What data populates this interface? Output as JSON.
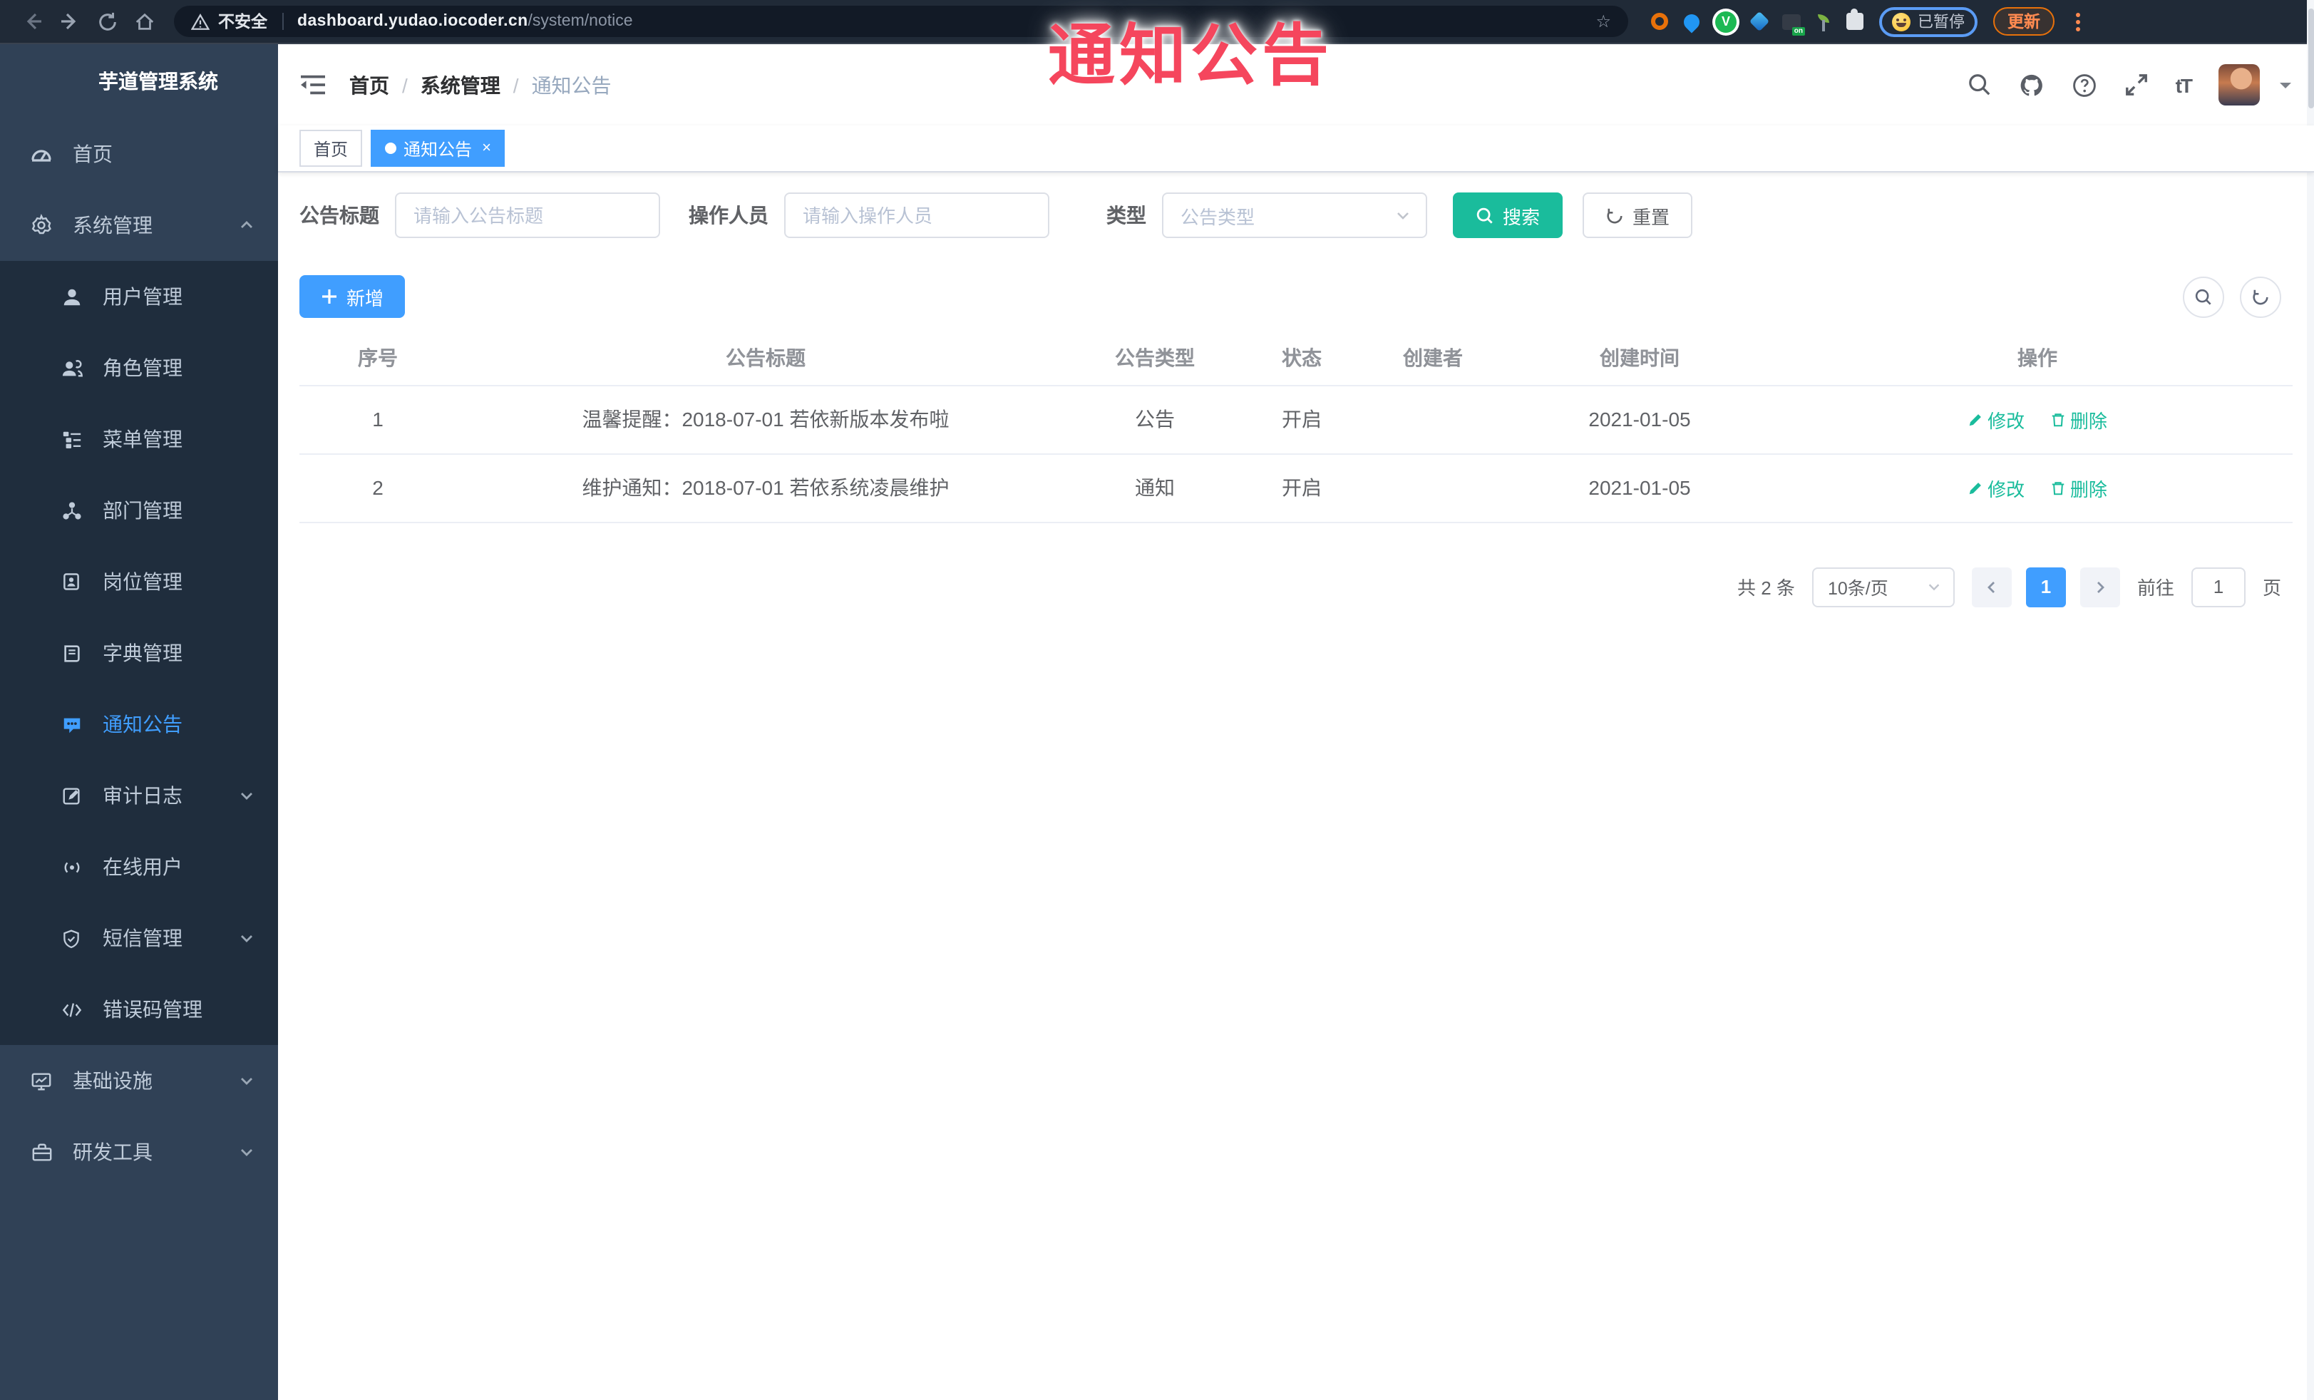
{
  "browser": {
    "security_label": "不安全",
    "url_host": "dashboard.yudao.iocoder.cn",
    "url_path": "/system/notice",
    "paused_badge": "已暂停",
    "update_label": "更新"
  },
  "overlay": {
    "text": "通知公告",
    "color": "#f5465d"
  },
  "sidebar": {
    "logo_title": "芋道管理系统",
    "items": [
      {
        "label": "首页",
        "level": "root",
        "icon": "dashboard-icon",
        "active": false
      },
      {
        "label": "系统管理",
        "level": "root",
        "icon": "gear-icon",
        "active": false,
        "arrow": "up"
      },
      {
        "label": "用户管理",
        "level": "sub",
        "icon": "user-icon",
        "active": false
      },
      {
        "label": "角色管理",
        "level": "sub",
        "icon": "users-icon",
        "active": false
      },
      {
        "label": "菜单管理",
        "level": "sub",
        "icon": "menu-tree-icon",
        "active": false
      },
      {
        "label": "部门管理",
        "level": "sub",
        "icon": "org-icon",
        "active": false
      },
      {
        "label": "岗位管理",
        "level": "sub",
        "icon": "badge-icon",
        "active": false
      },
      {
        "label": "字典管理",
        "level": "sub",
        "icon": "dict-icon",
        "active": false
      },
      {
        "label": "通知公告",
        "level": "sub",
        "icon": "notice-icon",
        "active": true
      },
      {
        "label": "审计日志",
        "level": "sub",
        "icon": "audit-icon",
        "active": false,
        "arrow": "down"
      },
      {
        "label": "在线用户",
        "level": "sub",
        "icon": "online-icon",
        "active": false
      },
      {
        "label": "短信管理",
        "level": "sub",
        "icon": "sms-shield-icon",
        "active": false,
        "arrow": "down"
      },
      {
        "label": "错误码管理",
        "level": "sub",
        "icon": "code-icon",
        "active": false
      },
      {
        "label": "基础设施",
        "level": "root",
        "icon": "monitor-icon",
        "active": false,
        "arrow": "down"
      },
      {
        "label": "研发工具",
        "level": "root",
        "icon": "toolbox-icon",
        "active": false,
        "arrow": "down"
      }
    ]
  },
  "navbar": {
    "breadcrumb": {
      "home": "首页",
      "section": "系统管理",
      "current": "通知公告"
    }
  },
  "tags": [
    {
      "label": "首页",
      "active": false
    },
    {
      "label": "通知公告",
      "active": true
    }
  ],
  "filters": {
    "title_label": "公告标题",
    "title_placeholder": "请输入公告标题",
    "operator_label": "操作人员",
    "operator_placeholder": "请输入操作人员",
    "type_label": "类型",
    "type_placeholder": "公告类型",
    "search_label": "搜索",
    "reset_label": "重置"
  },
  "toolbar": {
    "add_label": "新增"
  },
  "table": {
    "columns": [
      "序号",
      "公告标题",
      "公告类型",
      "状态",
      "创建者",
      "创建时间",
      "操作"
    ],
    "rows": [
      {
        "seq": "1",
        "title": "温馨提醒：2018-07-01 若依新版本发布啦",
        "type": "公告",
        "status": "开启",
        "creator": "",
        "create_time": "2021-01-05",
        "edit": "修改",
        "delete": "删除"
      },
      {
        "seq": "2",
        "title": "维护通知：2018-07-01 若依系统凌晨维护",
        "type": "通知",
        "status": "开启",
        "creator": "",
        "create_time": "2021-01-05",
        "edit": "修改",
        "delete": "删除"
      }
    ]
  },
  "pagination": {
    "total": "共 2 条",
    "page_size": "10条/页",
    "current_page": "1",
    "goto_label": "前往",
    "goto_value": "1",
    "page_unit": "页"
  },
  "colors": {
    "primary_blue": "#409EFF",
    "teal_action": "#1abc9c",
    "sidebar_bg": "#304156",
    "submenu_bg": "#1f2d3d",
    "chrome_bg": "#202a37",
    "overlay_red": "#f5465d"
  }
}
